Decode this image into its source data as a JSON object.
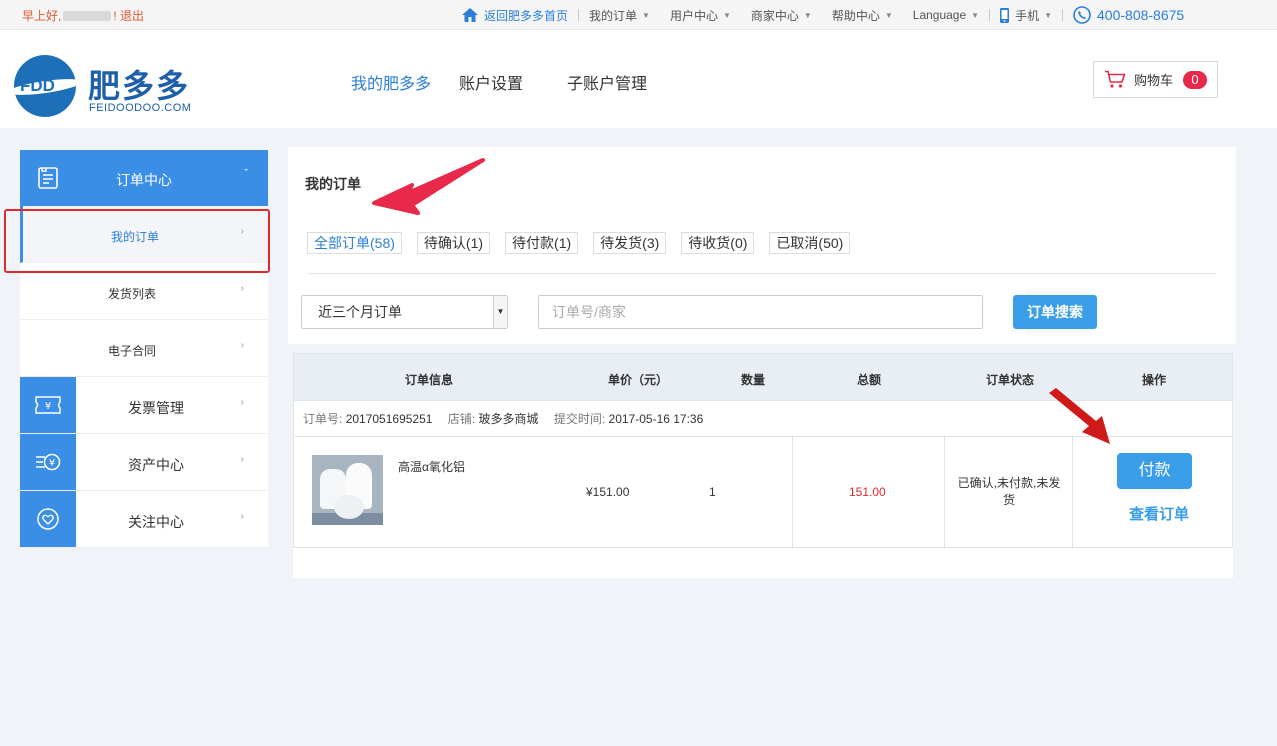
{
  "topbar": {
    "greeting": "早上好,",
    "greeting_tail": "!",
    "logout": "退出",
    "home_link": "返回肥多多首页",
    "my_orders": "我的订单",
    "user_center": "用户中心",
    "merchant_center": "商家中心",
    "help_center": "帮助中心",
    "language": "Language",
    "mobile": "手机",
    "phone": "400-808-8675"
  },
  "header": {
    "logo_badge": "FDD",
    "logo_cn": "肥多多",
    "logo_en": "FEIDOODOO.COM",
    "nav": [
      "我的肥多多",
      "账户设置",
      "子账户管理"
    ],
    "cart_label": "购物车",
    "cart_count": "0"
  },
  "sidebar": {
    "order_center": "订单中心",
    "sub_items": [
      "我的订单",
      "发货列表",
      "电子合同"
    ],
    "main_items": [
      "发票管理",
      "资产中心",
      "关注中心"
    ]
  },
  "orders": {
    "title": "我的订单",
    "tabs": [
      "全部订单(58)",
      "待确认(1)",
      "待付款(1)",
      "待发货(3)",
      "待收货(0)",
      "已取消(50)"
    ],
    "active_tab": "全部订单(58)",
    "range_select": "近三个月订单",
    "search_placeholder": "订单号/商家",
    "search_button": "订单搜索"
  },
  "table": {
    "headers": [
      "订单信息",
      "单价（元）",
      "数量",
      "总额",
      "订单状态",
      "操作"
    ],
    "order_no_label": "订单号:",
    "order_no": "2017051695251",
    "shop_label": "店铺:",
    "shop": "玻多多商城",
    "time_label": "提交时间:",
    "time": "2017-05-16 17:36",
    "row": {
      "product": "高温α氧化铝",
      "unit_price": "¥151.00",
      "quantity": "1",
      "total": "151.00",
      "status": "已确认,未付款,未发货",
      "pay_button": "付款",
      "view_link": "查看订单"
    }
  },
  "colors": {
    "accent": "#3a8ee6",
    "annotation_red": "#e02a2a"
  }
}
